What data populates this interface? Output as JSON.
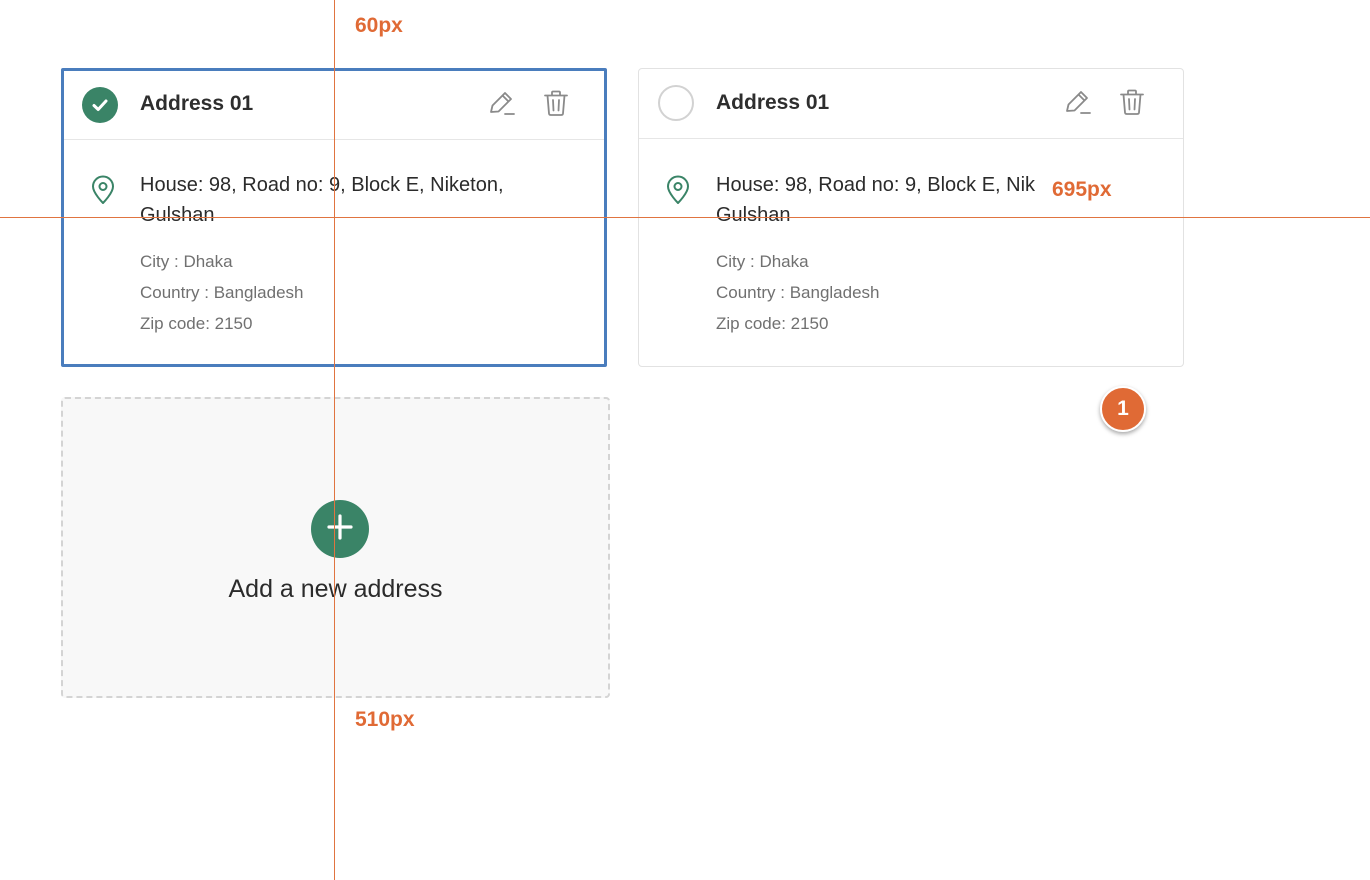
{
  "addresses": [
    {
      "title": "Address 01",
      "selected": true,
      "street": "House: 98, Road no: 9, Block E, Niketon, Gulshan",
      "city": "City : Dhaka",
      "country": "Country : Bangladesh",
      "zip": "Zip code: 2150"
    },
    {
      "title": "Address 01",
      "selected": false,
      "street": "House: 98, Road no: 9, Block E, Nik Gulshan",
      "city": "City : Dhaka",
      "country": "Country : Bangladesh",
      "zip": "Zip code: 2150"
    }
  ],
  "add_address": {
    "label": "Add a new address"
  },
  "annotations": {
    "top_spacing": "60px",
    "right_spacing": "695px",
    "bottom_spacing": "510px",
    "marker_number": "1"
  },
  "icons": {
    "selected": "check-circle-icon",
    "unselected": "radio-empty-icon",
    "edit": "pencil-icon",
    "delete": "trash-icon",
    "location": "map-pin-icon",
    "add": "plus-icon"
  },
  "colors": {
    "accent_green": "#3a8467",
    "selected_border": "#4a7dbd",
    "annotation_orange": "#e06a35",
    "muted_text": "#707070"
  }
}
